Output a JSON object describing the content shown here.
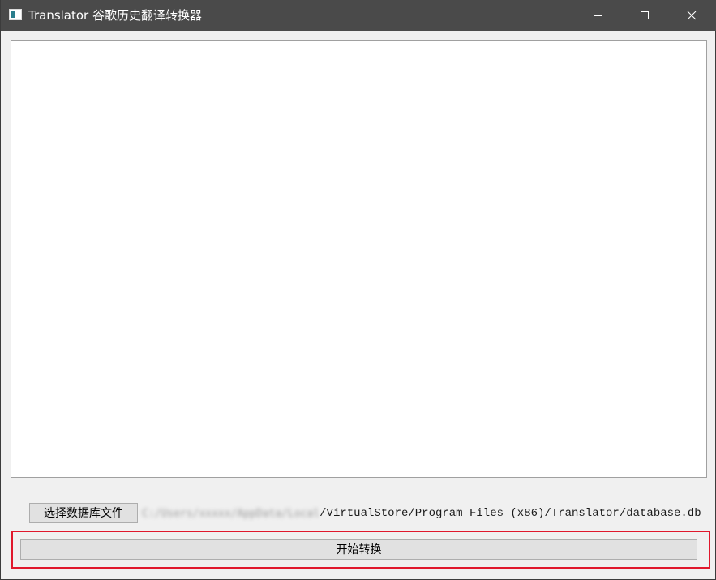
{
  "window": {
    "title": "Translator 谷歌历史翻译转换器",
    "icon": "app-window-icon",
    "controls": {
      "minimize_icon": "minimize-icon",
      "maximize_icon": "maximize-icon",
      "close_icon": "close-icon"
    }
  },
  "main": {
    "output_text": ""
  },
  "file_selector": {
    "button_label": "选择数据库文件",
    "path_obscured": "C:/Users/xxxxx/AppData/Local",
    "path_visible": "/VirtualStore/Program Files (x86)/Translator/database.db"
  },
  "actions": {
    "start_label": "开始转换",
    "highlight_color": "#e0182c"
  }
}
